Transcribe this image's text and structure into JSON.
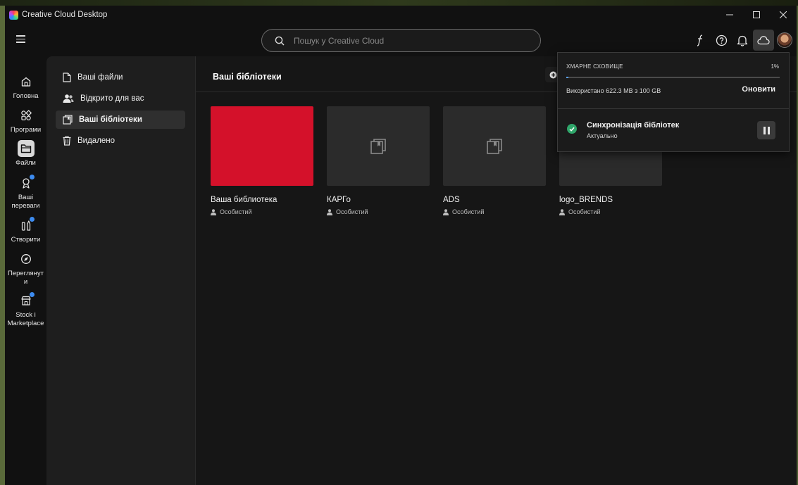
{
  "window": {
    "title": "Creative Cloud Desktop"
  },
  "header": {
    "search_placeholder": "Пошук у Creative Cloud"
  },
  "rail": {
    "items": [
      {
        "label": "Головна",
        "icon": "home-icon"
      },
      {
        "label": "Програми",
        "icon": "apps-icon"
      },
      {
        "label": "Файли",
        "icon": "folder-icon"
      },
      {
        "label": "Ваші переваги",
        "icon": "perks-icon"
      },
      {
        "label": "Створити",
        "icon": "create-icon"
      },
      {
        "label": "Переглянути",
        "icon": "discover-icon"
      },
      {
        "label": "Stock і Marketplace",
        "icon": "stock-icon"
      }
    ]
  },
  "sidebar": {
    "items": [
      {
        "label": "Ваші файли",
        "icon": "file-icon"
      },
      {
        "label": "Відкрито для вас",
        "icon": "shared-icon"
      },
      {
        "label": "Ваші бібліотеки",
        "icon": "library-icon"
      },
      {
        "label": "Видалено",
        "icon": "trash-icon"
      }
    ]
  },
  "main": {
    "title": "Ваші бібліотеки",
    "libraries": [
      {
        "name": "Ваша библиотека",
        "owner": "Особистий",
        "thumb_color": "#d4112a"
      },
      {
        "name": "КАРГо",
        "owner": "Особистий"
      },
      {
        "name": "ADS",
        "owner": "Особистий"
      },
      {
        "name": "logo_BRENDS",
        "owner": "Особистий"
      }
    ]
  },
  "cloud_popover": {
    "storage_caption": "ХМАРНЕ СХОВИЩЕ",
    "storage_percent": "1%",
    "storage_fraction": 0.01,
    "storage_used": "Використано 622.3 MB з 100 GB",
    "update_label": "Оновити",
    "sync_title": "Синхронізація бібліотек",
    "sync_status": "Актуально"
  },
  "colors": {
    "accent_blue": "#3d8cf0",
    "sync_ok": "#2fa66a",
    "library_red": "#d4112a"
  }
}
